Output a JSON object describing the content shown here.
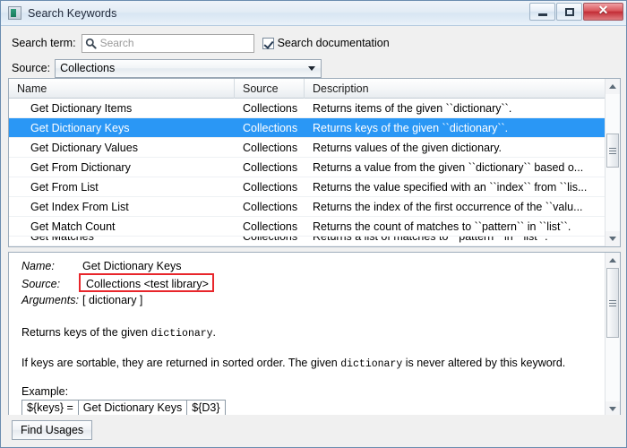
{
  "window": {
    "title": "Search Keywords",
    "icon": "app-icon",
    "buttons": {
      "minimize": "minimize",
      "maximize": "maximize",
      "close": "close"
    }
  },
  "search": {
    "label": "Search term:",
    "placeholder": "Search",
    "value": "",
    "icon": "search-icon",
    "doc_checkbox_label": "Search documentation",
    "doc_checkbox_checked": true
  },
  "source": {
    "label": "Source:",
    "value": "Collections",
    "options": [
      "Collections"
    ]
  },
  "table": {
    "columns": [
      "Name",
      "Source",
      "Description"
    ],
    "rows": [
      {
        "name": "Get Dictionary Items",
        "source": "Collections",
        "description": "Returns items of the given ``dictionary``.",
        "selected": false
      },
      {
        "name": "Get Dictionary Keys",
        "source": "Collections",
        "description": "Returns keys of the given ``dictionary``.",
        "selected": true
      },
      {
        "name": "Get Dictionary Values",
        "source": "Collections",
        "description": "Returns values of the given dictionary.",
        "selected": false
      },
      {
        "name": "Get From Dictionary",
        "source": "Collections",
        "description": "Returns a value from the given ``dictionary`` based o...",
        "selected": false
      },
      {
        "name": "Get From List",
        "source": "Collections",
        "description": "Returns the value specified with an ``index`` from ``lis...",
        "selected": false
      },
      {
        "name": "Get Index From List",
        "source": "Collections",
        "description": "Returns the index of the first occurrence of the ``valu...",
        "selected": false
      },
      {
        "name": "Get Match Count",
        "source": "Collections",
        "description": "Returns the count of matches to ``pattern`` in ``list``.",
        "selected": false
      },
      {
        "name": "Get Matches",
        "source": "Collections",
        "description": "Returns a list of matches to ``pattern`` in ``list``.",
        "selected": false
      }
    ]
  },
  "details": {
    "name_key": "Name:",
    "name_value": "Get Dictionary Keys",
    "source_key": "Source:",
    "source_value": "Collections <test library>",
    "source_highlighted": true,
    "arguments_key": "Arguments:",
    "arguments_value": "[ dictionary ]",
    "doc_para1_a": "Returns keys of the given ",
    "doc_para1_code": "dictionary",
    "doc_para1_b": ".",
    "doc_para2_a": "If keys are sortable, they are returned in sorted order. The given ",
    "doc_para2_code": "dictionary",
    "doc_para2_b": " is never altered by this keyword.",
    "example_label": "Example:",
    "example_cells": [
      "${keys} =",
      "Get Dictionary Keys",
      "${D3}"
    ]
  },
  "footer": {
    "find_usages_label": "Find Usages"
  },
  "colors": {
    "selection": "#2a97f5",
    "highlight_border": "#e8262b",
    "window_border": "#6a8caf"
  }
}
